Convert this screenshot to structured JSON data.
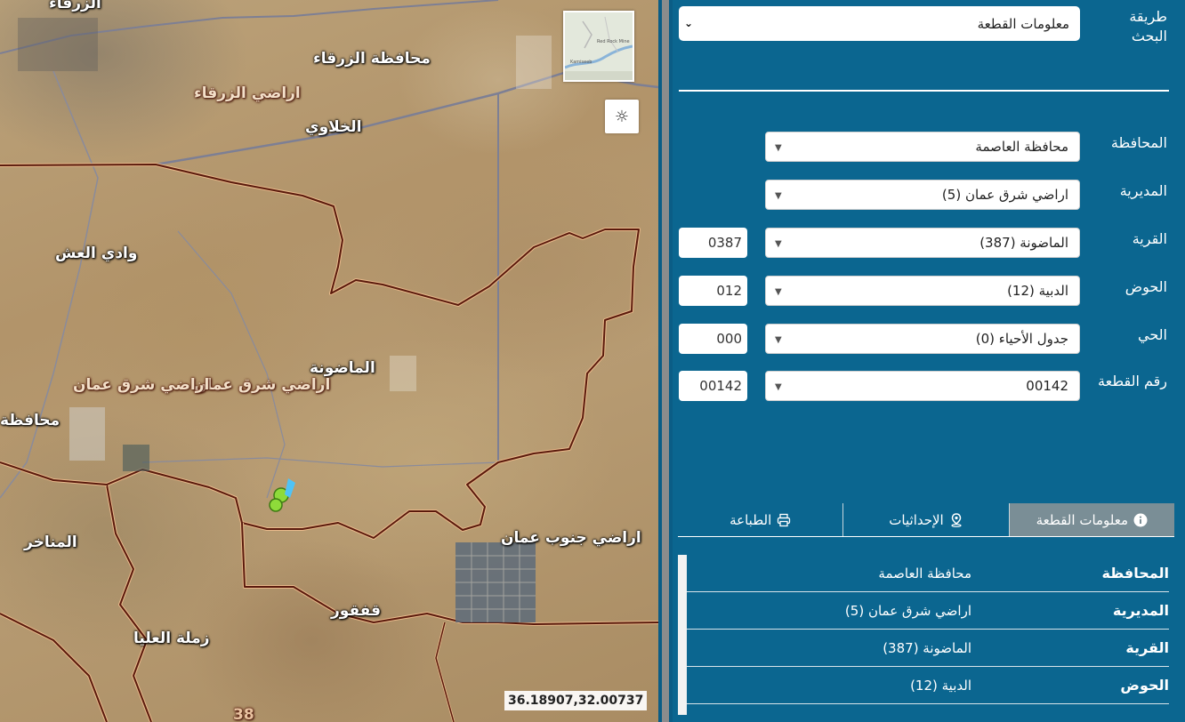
{
  "map": {
    "labels": [
      {
        "text": "الزرقاء",
        "kind": "place"
      },
      {
        "text": "محافظة الزرقاء",
        "kind": "place"
      },
      {
        "text": "اراضي الزرقاء",
        "kind": "region"
      },
      {
        "text": "الخلاوي",
        "kind": "place"
      },
      {
        "text": "وادي العش",
        "kind": "place"
      },
      {
        "text": "الماضونة",
        "kind": "place"
      },
      {
        "text": "اراضي شرق عمان",
        "kind": "region"
      },
      {
        "text": "اراضي شرق عمان",
        "kind": "region"
      },
      {
        "text": "محافظة",
        "kind": "place"
      },
      {
        "text": "المناخر",
        "kind": "place"
      },
      {
        "text": "اراضي جنوب عمان",
        "kind": "place"
      },
      {
        "text": "قفقور",
        "kind": "place"
      },
      {
        "text": "زملة العليا",
        "kind": "place"
      },
      {
        "text": "38",
        "kind": "region"
      }
    ],
    "minimap": {
      "labels": [
        "Kamiseeb",
        "Red Rock Mine"
      ]
    },
    "theme_button_icon": "sun-icon",
    "coordinates": "36.18907,32.00737",
    "colors": {
      "boundary": "#5a1a0c",
      "boundary_inner": "#e8b88a",
      "admin_line": "#7d7f94",
      "marker": "#8edb3a",
      "marker_pin": "#4fc3f7"
    }
  },
  "panel": {
    "search_method": {
      "label": "طريقة البحث",
      "value": "معلومات القطعة"
    },
    "fields": [
      {
        "key": "governorate",
        "label": "المحافظة",
        "value": "محافظة العاصمة",
        "code": null
      },
      {
        "key": "directorate",
        "label": "المديرية",
        "value": "اراضي شرق عمان (5)",
        "code": null
      },
      {
        "key": "village",
        "label": "القرية",
        "value": "الماضونة (387)",
        "code": "0387"
      },
      {
        "key": "basin",
        "label": "الحوض",
        "value": "الدبية (12)",
        "code": "012"
      },
      {
        "key": "neighborhood",
        "label": "الحي",
        "value": "جدول الأحياء (0)",
        "code": "000"
      },
      {
        "key": "parcel",
        "label": "رقم القطعة",
        "value": "00142",
        "code": "00142"
      }
    ],
    "tabs": [
      {
        "label": "معلومات القطعة",
        "icon": "info-icon",
        "active": true
      },
      {
        "label": "الإحداثيات",
        "icon": "map-pin-icon",
        "active": false
      },
      {
        "label": "الطباعة",
        "icon": "printer-icon",
        "active": false
      }
    ],
    "info_rows": [
      {
        "key": "المحافظة",
        "value": "محافظة العاصمة"
      },
      {
        "key": "المديرية",
        "value": "اراضي شرق عمان (5)"
      },
      {
        "key": "القرية",
        "value": "الماضونة (387)"
      },
      {
        "key": "الحوض",
        "value": "الدبية (12)"
      }
    ],
    "colors": {
      "background": "#0b6690",
      "active_tab": "#7a8e96"
    }
  }
}
